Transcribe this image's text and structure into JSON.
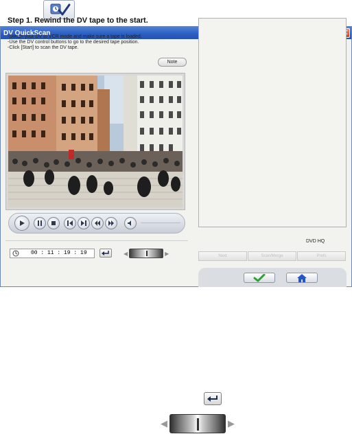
{
  "window": {
    "title": "DV QuickScan",
    "close_glyph": "✕"
  },
  "step": {
    "title": "Step 1. Rewind the DV tape to the start.",
    "instructions": [
      "-Switch your DV to VCR mode and make sure a tape is loaded.",
      "-Use the DV control buttons to go to the desired tape position.",
      "-Click [Start] to scan the DV tape."
    ],
    "note_label": "Note"
  },
  "timecode": {
    "value": "00 : 11 : 19 : 19"
  },
  "right_panel": {
    "format_label": "DVD HQ",
    "disabled_buttons": [
      "Next",
      "Scan/Merge",
      "Prefs"
    ]
  },
  "icons": {
    "top": "scan-check-icon",
    "controls": [
      "play-icon",
      "pause-icon",
      "stop-icon",
      "prev-frame-icon",
      "next-frame-icon",
      "rewind-icon",
      "fast-forward-icon",
      "volume-icon"
    ],
    "ok": "checkmark-icon",
    "home": "home-icon"
  },
  "colors": {
    "titlebar": "#2a5dc0",
    "ok_green": "#2ea036",
    "home_blue": "#2456c8"
  }
}
